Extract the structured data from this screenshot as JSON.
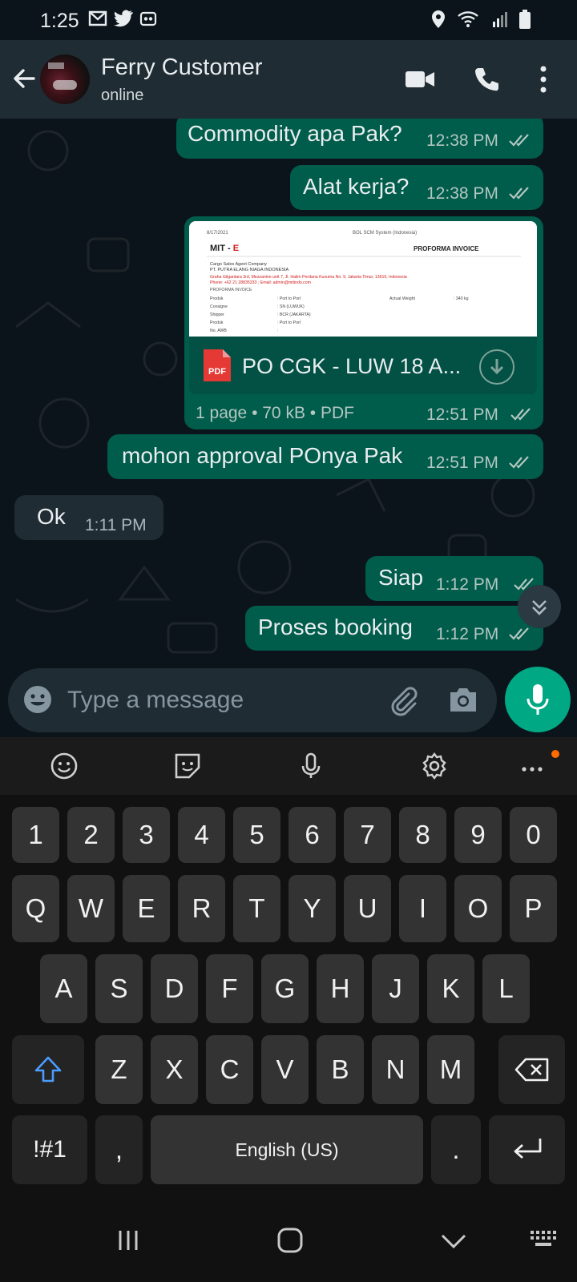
{
  "status_bar": {
    "time": "1:25"
  },
  "header": {
    "contact_name": "Ferry Customer",
    "contact_status": "online"
  },
  "messages": [
    {
      "direction": "out",
      "text": "Commodity apa Pak?",
      "time": "12:38 PM",
      "status": "read"
    },
    {
      "direction": "out",
      "text": "Alat kerja?",
      "time": "12:38 PM",
      "status": "read"
    },
    {
      "direction": "out",
      "type": "document",
      "file_name": "PO CGK - LUW 18 A...",
      "file_type_badge": "PDF",
      "meta": "1 page • 70 kB • PDF",
      "time": "12:51 PM",
      "status": "read",
      "preview": {
        "date": "8/17/2021",
        "system": "BOL SCM System (Indonesia)",
        "logo_text": "MIT - ",
        "logo_accent": "E",
        "doc_title": "PROFORMA INVOICE",
        "line1": "Cargo Sales Agent Company",
        "line2": "PT. PUTRA ELANG NIAGA INDONESIA",
        "line3": "Graha Gilgantara 3rd, Mezzanine unit 7, Jl. Halim Perdana Kusuma No. 9, Jakarta Timur, 13610, Indonesia",
        "line4": "Phone: +62 21 28835333 ; Email: admin@mitindo.com",
        "line5": "PROFORMA INVOICE",
        "rows": [
          {
            "label": "Produk",
            "value": ": Port to Port"
          },
          {
            "label": "Consigne",
            "value": ": SN (LUWUK)"
          },
          {
            "label": "Shipper",
            "value": ": BCR (JAKARTA)"
          },
          {
            "label": "Produk",
            "value": ": Port to Port"
          },
          {
            "label": "No. AWB",
            "value": ":"
          }
        ],
        "weight_label": "Actual Weight",
        "weight_value": ": 340 kg"
      }
    },
    {
      "direction": "out",
      "text": "mohon approval POnya Pak",
      "time": "12:51 PM",
      "status": "read"
    },
    {
      "direction": "in",
      "text": "Ok",
      "time": "1:11 PM"
    },
    {
      "direction": "out",
      "text": "Siap",
      "time": "1:12 PM",
      "status": "read"
    },
    {
      "direction": "out",
      "text": "Proses booking",
      "time": "1:12 PM",
      "status": "read"
    }
  ],
  "composer": {
    "placeholder": "Type a message"
  },
  "keyboard": {
    "row_numbers": [
      "1",
      "2",
      "3",
      "4",
      "5",
      "6",
      "7",
      "8",
      "9",
      "0"
    ],
    "row_q": [
      "Q",
      "W",
      "E",
      "R",
      "T",
      "Y",
      "U",
      "I",
      "O",
      "P"
    ],
    "row_a": [
      "A",
      "S",
      "D",
      "F",
      "G",
      "H",
      "J",
      "K",
      "L"
    ],
    "row_z": [
      "Z",
      "X",
      "C",
      "V",
      "B",
      "N",
      "M"
    ],
    "symbols_key": "!#1",
    "comma_key": ",",
    "space_label": "English (US)",
    "period_key": "."
  },
  "colors": {
    "outgoing_bubble": "#005c4b",
    "incoming_bubble": "#202c33",
    "accent": "#00a884",
    "header_bg": "#1f2c33",
    "chat_bg": "#0b141a"
  }
}
